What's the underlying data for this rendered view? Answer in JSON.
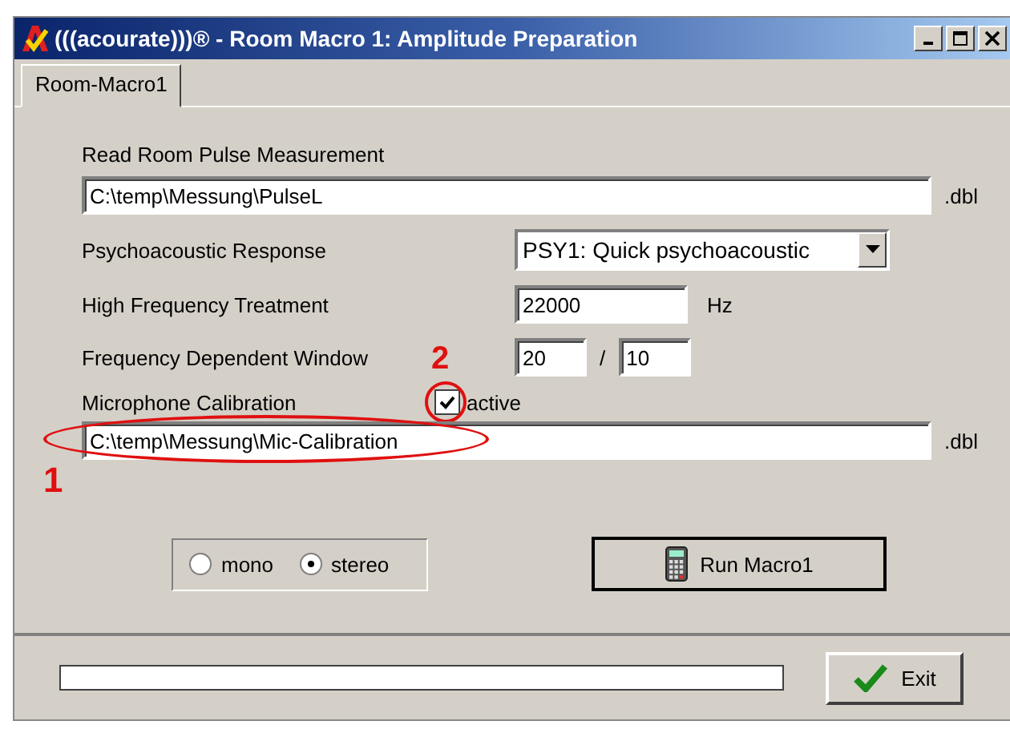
{
  "window": {
    "title": "(((acourate)))® - Room Macro 1: Amplitude Preparation"
  },
  "tabs": [
    {
      "label": "Room-Macro1",
      "selected": true
    }
  ],
  "pulse": {
    "label": "Read Room Pulse Measurement",
    "value": "C:\\temp\\Messung\\PulseL",
    "suffix": ".dbl"
  },
  "psychoacoustic": {
    "label": "Psychoacoustic Response",
    "value": "PSY1: Quick psychoacoustic"
  },
  "hf_treatment": {
    "label": "High Frequency Treatment",
    "value": "22000",
    "unit": "Hz"
  },
  "fdw": {
    "label": "Frequency Dependent Window",
    "value_1": "20",
    "separator": "/",
    "value_2": "10"
  },
  "mic_calibration": {
    "label": "Microphone Calibration",
    "checkbox_label": "active",
    "checked": true,
    "value": "C:\\temp\\Messung\\Mic-Calibration",
    "suffix": ".dbl"
  },
  "channel_mode": [
    {
      "label": "mono",
      "selected": false
    },
    {
      "label": "stereo",
      "selected": true
    }
  ],
  "run_button": "Run Macro1",
  "progress": {
    "level": 0
  },
  "exit_button": "Exit",
  "annotations": [
    {
      "label": "1"
    },
    {
      "label": "2"
    }
  ]
}
